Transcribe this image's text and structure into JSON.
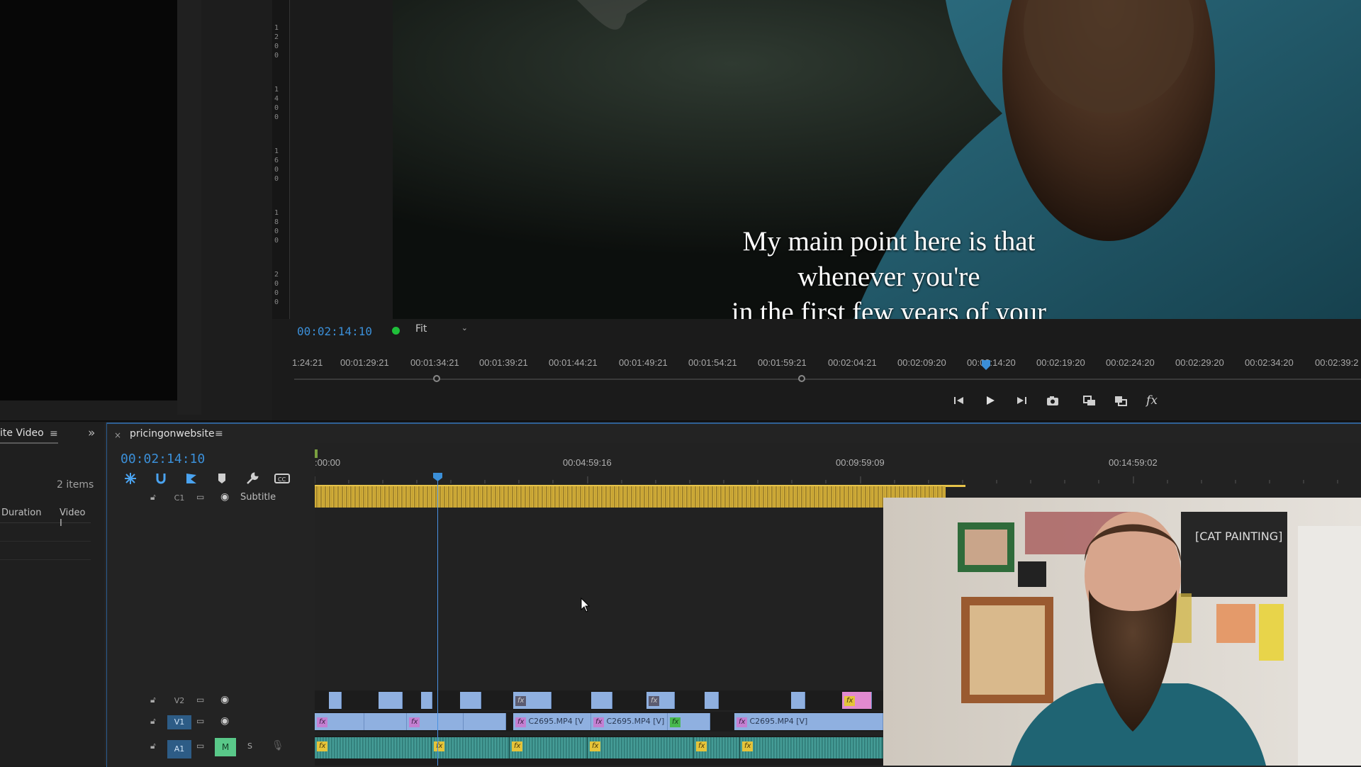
{
  "monitor": {
    "subtitle_line1": "My main point here is that whenever you're",
    "subtitle_line2": "in the first few years of your business",
    "timecode": "00:02:14:10",
    "zoom": "Fit",
    "ruler_digits": [
      "1",
      "2",
      "0",
      "0",
      "1",
      "4",
      "0",
      "0",
      "1",
      "6",
      "0",
      "0",
      "1",
      "8",
      "0",
      "0",
      "2",
      "0",
      "0",
      "0"
    ],
    "time_ruler_labels": [
      "1:24:21",
      "00:01:29:21",
      "00:01:34:21",
      "00:01:39:21",
      "00:01:44:21",
      "00:01:49:21",
      "00:01:54:21",
      "00:01:59:21",
      "00:02:04:21",
      "00:02:09:20",
      "00:02:14:20",
      "00:02:19:20",
      "00:02:24:20",
      "00:02:29:20",
      "00:02:34:20",
      "00:02:39:2"
    ],
    "transport": {
      "step_back": "step-back-icon",
      "play": "play-icon",
      "step_forward": "step-forward-icon",
      "export_frame": "camera-icon",
      "insert": "insert-icon",
      "overwrite": "overwrite-icon",
      "fx_label": "fx"
    }
  },
  "project_bin": {
    "tab_label": "ite Video",
    "item_count": "2 items",
    "columns": [
      "Duration",
      "Video I"
    ]
  },
  "timeline": {
    "sequence_name": "pricingonwebsite",
    "close_glyph": "×",
    "timecode": "00:02:14:10",
    "ruler_labels": [
      ":00:00",
      "00:04:59:16",
      "00:09:59:09",
      "00:14:59:02"
    ],
    "tools": [
      "snap-icon",
      "linked-selection-icon",
      "marker-icon",
      "add-marker-icon",
      "wrench-icon",
      "captions-icon"
    ],
    "tracks": {
      "caption": {
        "name": "C1",
        "label": "Subtitle"
      },
      "v2": {
        "name": "V2"
      },
      "v1": {
        "name": "V1",
        "clip_labels": [
          "C2695.MP4 [V",
          "C2695.MP4 [V]",
          "C2695.MP4 [V]"
        ]
      },
      "a1": {
        "name": "A1",
        "mute": "M",
        "solo": "S"
      }
    },
    "fx_label": "fx"
  },
  "colors": {
    "accent_blue": "#3b8fd8",
    "caption_yellow": "#d8b440",
    "video_clip": "#8fb0e0",
    "audio_clip": "#3f9a94",
    "fx_purple": "#c47fd1",
    "fx_yellow": "#e5c43a",
    "mute_green": "#59c889"
  }
}
